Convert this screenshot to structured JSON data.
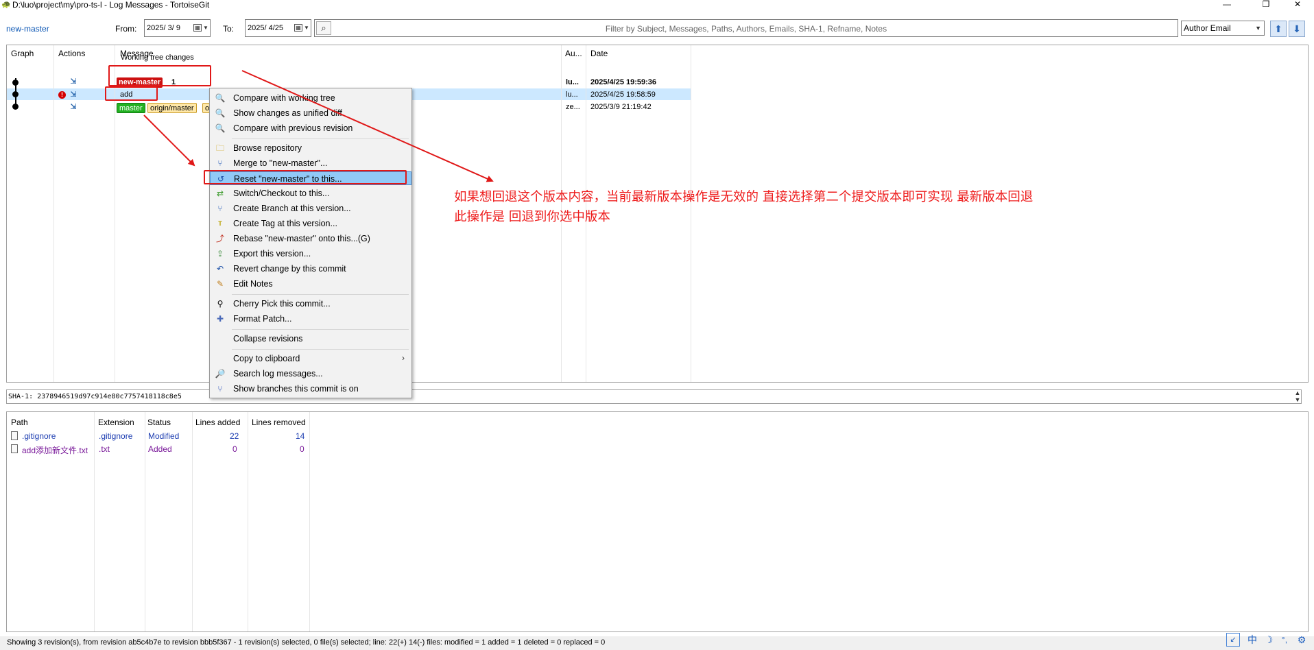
{
  "window": {
    "title": "D:\\luo\\project\\my\\pro-ts-l - Log Messages - TortoiseGit",
    "app_icon": "tortoisegit-icon",
    "controls": {
      "minimize": "—",
      "restore": "❐",
      "close": "✕"
    }
  },
  "toolbar": {
    "branch": "new-master",
    "from_label": "From:",
    "from_date": "2025/  3/  9",
    "to_label": "To:",
    "to_date": "2025/  4/25",
    "filter_placeholder": "Filter by Subject, Messages, Paths, Authors, Emails, SHA-1, Refname, Notes",
    "filter_field": "Author Email"
  },
  "log": {
    "columns": [
      "Graph",
      "Actions",
      "Message",
      "Au...",
      "Date"
    ],
    "working_tree": "Working tree changes",
    "rows": [
      {
        "tags": [
          "new-master"
        ],
        "message": "1",
        "author": "lu...",
        "date": "2025/4/25 19:59:36",
        "bold": true
      },
      {
        "tags": [],
        "message": "add",
        "author": "lu...",
        "date": "2025/4/25 19:58:59",
        "selected": true
      },
      {
        "tags": [
          "master",
          "origin/master",
          "o"
        ],
        "message": "",
        "author": "ze...",
        "date": "2025/3/9 21:19:42"
      }
    ]
  },
  "sha_line": "SHA-1: 2378946519d97c914e80c7757418118c8e5",
  "context_menu": {
    "items": [
      {
        "label": "Compare with working tree",
        "icon": "magnifier-icon"
      },
      {
        "label": "Show changes as unified diff",
        "icon": "magnifier-icon"
      },
      {
        "label": "Compare with previous revision",
        "icon": "magnifier-icon"
      },
      {
        "label": "Browse repository",
        "icon": "repo-browser-icon"
      },
      {
        "label": "Merge to \"new-master\"...",
        "icon": "merge-icon"
      },
      {
        "label": "Reset \"new-master\" to this...",
        "icon": "reset-icon"
      },
      {
        "label": "Switch/Checkout to this...",
        "icon": "switch-icon"
      },
      {
        "label": "Create Branch at this version...",
        "icon": "branch-icon"
      },
      {
        "label": "Create Tag at this version...",
        "icon": "tag-icon"
      },
      {
        "label": "Rebase \"new-master\" onto this...(G)",
        "icon": "rebase-icon"
      },
      {
        "label": "Export this version...",
        "icon": "export-icon"
      },
      {
        "label": "Revert change by this commit",
        "icon": "revert-icon"
      },
      {
        "label": "Edit Notes",
        "icon": "notes-icon"
      },
      {
        "label": "Cherry Pick this commit...",
        "icon": "cherry-pick-icon"
      },
      {
        "label": "Format Patch...",
        "icon": "patch-icon"
      },
      {
        "label": "Collapse revisions",
        "icon": ""
      },
      {
        "label": "Copy to clipboard",
        "icon": "",
        "submenu": "›"
      },
      {
        "label": "Search log messages...",
        "icon": "search-icon"
      },
      {
        "label": "Show branches this commit is on",
        "icon": "branches-icon"
      }
    ]
  },
  "files": {
    "columns": [
      "Path",
      "Extension",
      "Status",
      "Lines added",
      "Lines removed"
    ],
    "rows": [
      {
        "path": ".gitignore",
        "ext": ".gitignore",
        "status": "Modified",
        "added": "22",
        "removed": "14"
      },
      {
        "path": "add添加新文件.txt",
        "ext": ".txt",
        "status": "Added",
        "added": "0",
        "removed": "0"
      }
    ]
  },
  "status": "Showing 3 revision(s), from revision ab5c4b7e to revision bbb5f367 - 1 revision(s) selected, 0 file(s) selected; line: 22(+) 14(-) files: modified = 1 added = 1 deleted = 0 replaced = 0",
  "ime": {
    "lang": "中",
    "moon": "☽",
    "gear": "⚙"
  },
  "annotation": {
    "line1": "如果想回退这个版本内容，当前最新版本操作是无效的 直接选择第二个提交版本即可实现 最新版本回退",
    "line2": "此操作是 回退到你选中版本",
    "color": "#ee1c1c"
  }
}
